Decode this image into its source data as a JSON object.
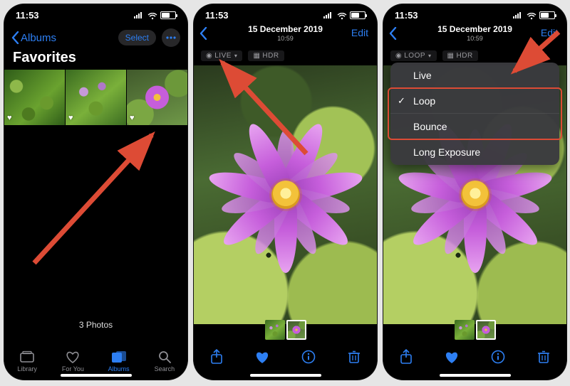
{
  "status_time": "11:53",
  "phone1": {
    "back_label": "Albums",
    "select_label": "Select",
    "title": "Favorites",
    "count_label": "3 Photos",
    "tabs": [
      {
        "label": "Library"
      },
      {
        "label": "For You"
      },
      {
        "label": "Albums"
      },
      {
        "label": "Search"
      }
    ]
  },
  "phone2": {
    "date_line1": "15 December 2019",
    "date_line2": "10:59",
    "edit_label": "Edit",
    "live_badge": "LIVE",
    "hdr_badge": "HDR"
  },
  "phone3": {
    "date_line1": "15 December 2019",
    "date_line2": "10:59",
    "edit_label": "Edit",
    "loop_badge": "LOOP",
    "hdr_badge": "HDR",
    "menu": [
      {
        "label": "Live",
        "checked": false
      },
      {
        "label": "Loop",
        "checked": true
      },
      {
        "label": "Bounce",
        "checked": false
      },
      {
        "label": "Long Exposure",
        "checked": false
      }
    ]
  }
}
